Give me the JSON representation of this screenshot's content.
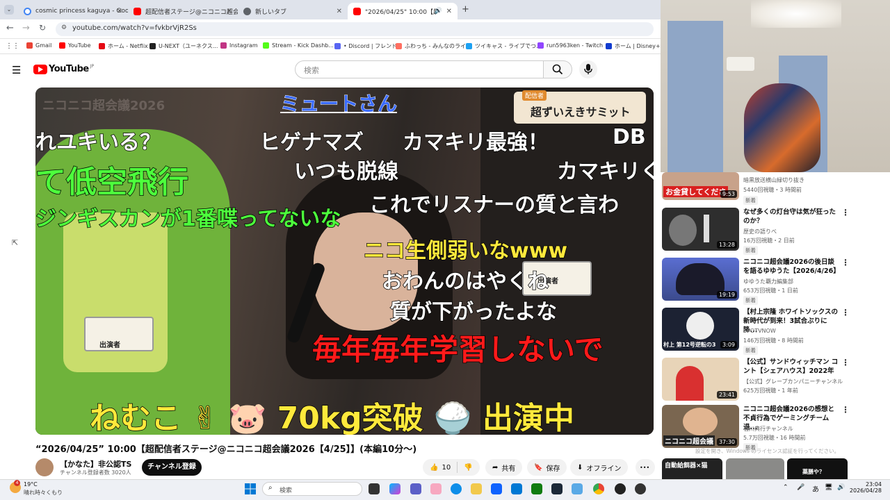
{
  "browser": {
    "tabs": [
      {
        "title": "cosmic princess kaguya - Goog",
        "color": "#4285f4"
      },
      {
        "title": "超配信者ステージ@ニコニコ超会議",
        "color": "#ff0000"
      },
      {
        "title": "新しいタブ",
        "color": "#5f6368"
      },
      {
        "title": "\"2026/04/25\" 10:00【超配信",
        "color": "#ff0000"
      }
    ],
    "new_tab": "+",
    "url": "youtube.com/watch?v=fvkbrVjR2Ss",
    "bookmarks": [
      "Gmail",
      "YouTube",
      "ホーム - Netflix",
      "U-NEXT（ユーネクス...",
      "Instagram",
      "Stream - Kick Dashb...",
      "• Discord | フレンド",
      "ふわっち - みんなのライ...",
      "ツイキャス - ライブでつ...",
      "run5963ken - Twitch",
      "ホーム | Disney+(ディ"
    ]
  },
  "youtube": {
    "logo": "YouTube",
    "logo_sup": "JP",
    "search_placeholder": "検索"
  },
  "video": {
    "comments": [
      "ミュートさん",
      "超ずいえきサミット",
      "れユキいる？",
      "ヒゲナマズ",
      "カマキリ最強！",
      "DB",
      "て低空飛行",
      "いつも脱線",
      "カマキリく",
      "これでリスナーの質と言わ",
      "ジンギスカンが1番喋ってないな",
      "ニコ生側弱いなwww",
      "おわんのはやくね",
      "質が下がったよな",
      "毎年毎年学習しないで",
      "ねむこ ✌ 🐷 70kg突破 🍚 出演中"
    ],
    "overlay_logo": "ニコニコ超会議2026",
    "badge_label": "配信者",
    "name_card": "出演者"
  },
  "watch": {
    "title": "“2026/04/25” 10:00【超配信者ステージ@ニコニコ超会議2026【4/25】】(本編10分〜)",
    "channel": "【かなた】非公認TS",
    "subs": "チャンネル登録者数 3020人",
    "subscribe": "チャンネル登録",
    "likes": "10",
    "share": "共有",
    "save": "保存",
    "offline": "オフライン",
    "more": "•••"
  },
  "recommendations": [
    {
      "title": "",
      "channel": "暗黒放送横山緑切り抜き",
      "meta": "5440回視聴・3 時間前",
      "badge": "新着",
      "duration": "9:53",
      "thumb_color": "#c8a28a",
      "thumb_text": "お金貸してくださ"
    },
    {
      "title": "なぜ多くの灯台守は気が狂ったのか？",
      "channel": "歴史の語りべ",
      "meta": "16万回視聴・2 日前",
      "badge": "新着",
      "duration": "13:28",
      "thumb_color": "#2e2e2e",
      "thumb_text": ""
    },
    {
      "title": "ニコニコ超会議2026の後日談を語るゆゆうた【2026/4/26】",
      "channel": "ゆゆうた覇力編集部",
      "meta": "653万回視聴・1 日前",
      "badge": "新着",
      "duration": "19:19",
      "thumb_color": "#3b4a8c",
      "thumb_text": ""
    },
    {
      "title": "【村上宗隆 ホワイトソックスの新時代が到来！3試合ぶりに降...",
      "channel": "SPOTVNOW",
      "meta": "146万回視聴・8 時間前",
      "badge": "新着",
      "duration": "3:09",
      "thumb_color": "#1c2233",
      "thumb_text": "村上 第12号逆転の3"
    },
    {
      "title": "【公式】サンドウィッチマン コント【シェアハウス】2022年",
      "channel": "【公式】グレープカンパニーチャンネル",
      "meta": "625万回視聴・1 年前",
      "badge": "",
      "duration": "23:41",
      "thumb_color": "#e8d4b8",
      "thumb_text": ""
    },
    {
      "title": "ニコニコ超会議2026の感想と不貞行為でゲーミングチーム退...",
      "channel": "石川典行チャンネル",
      "meta": "5.7万回視聴・16 時間前",
      "badge": "新着",
      "duration": "37:30",
      "thumb_color": "#7a6650",
      "thumb_text": "ニコニコ超会議"
    }
  ],
  "partial_thumbs": [
    "自動給餌器×猫",
    "",
    "薬膳や？"
  ],
  "windows_overlay": "設定を開き、Windows のライセンス認証を行ってください。",
  "taskbar": {
    "weather_temp": "19°C",
    "weather_desc": "晴れ時々くもり",
    "weather_badge": "4",
    "search_placeholder": "検索",
    "time": "23:04",
    "date": "2026/04/28",
    "ime": "あ"
  }
}
